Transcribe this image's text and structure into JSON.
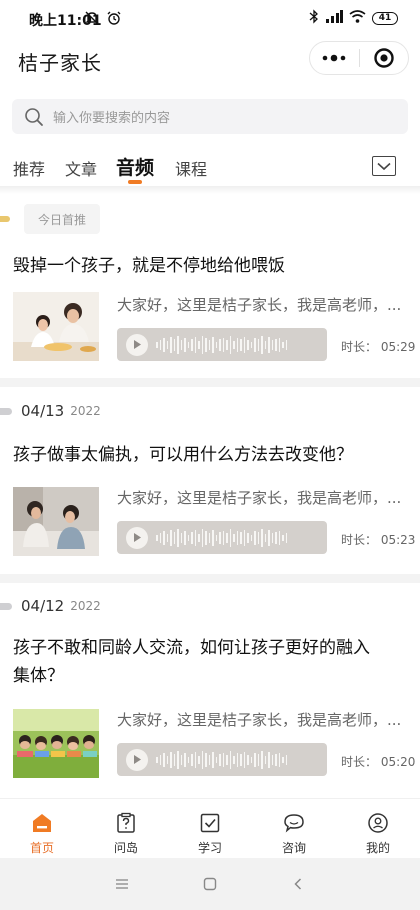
{
  "status_bar": {
    "time": "晚上11:01",
    "battery": "41",
    "icons": [
      "mute-icon",
      "alarm-icon",
      "bluetooth-icon",
      "signal-icon",
      "wifi-icon",
      "battery-icon"
    ]
  },
  "header": {
    "title": "桔子家长",
    "capsule_icons": [
      "more-dots-icon",
      "close-target-icon"
    ]
  },
  "search": {
    "placeholder": "输入你要搜索的内容",
    "icon": "search-icon"
  },
  "tabs": {
    "items": [
      {
        "label": "推荐"
      },
      {
        "label": "文章"
      },
      {
        "label": "音频",
        "active": true
      },
      {
        "label": "课程"
      }
    ],
    "more_icon": "chevron-down-icon",
    "accent_color": "#f07b24"
  },
  "feed": {
    "items": [
      {
        "tag": "今日首推",
        "title": "毁掉一个孩子，就是不停地给他喂饭",
        "excerpt": "大家好，这里是桔子家长，我是高老师，...",
        "duration": "时长：  05:29",
        "thumb": "mother-child-eating"
      },
      {
        "date": "04/13",
        "year": "2022",
        "title": "孩子做事太偏执，可以用什么方法去改变他？",
        "excerpt": "大家好，这里是桔子家长，我是高老师，...",
        "duration": "时长：  05:23",
        "thumb": "two-children-sofa"
      },
      {
        "date": "04/12",
        "year": "2022",
        "title_lines": [
          "孩子不敢和同龄人交流，如何让孩子更好的融入",
          "集体？"
        ],
        "excerpt": "大家好，这里是桔子家长，我是高老师，...",
        "duration": "时长：  05:20",
        "thumb": "children-on-grass"
      }
    ]
  },
  "bottom_nav": {
    "items": [
      {
        "label": "首页",
        "icon": "home-icon",
        "active": true
      },
      {
        "label": "问岛",
        "icon": "question-island-icon"
      },
      {
        "label": "学习",
        "icon": "study-check-icon"
      },
      {
        "label": "咨询",
        "icon": "chat-bubble-icon"
      },
      {
        "label": "我的",
        "icon": "profile-icon"
      }
    ],
    "active_color": "#e8702a"
  },
  "system_nav": {
    "icons": [
      "menu-icon",
      "home-square-icon",
      "back-icon"
    ]
  }
}
